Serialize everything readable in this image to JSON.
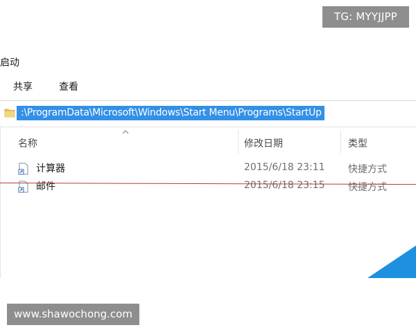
{
  "watermarks": {
    "top_right": "TG: MYYJJPP",
    "bottom_left": "www.shawochong.com"
  },
  "window": {
    "title": "启动"
  },
  "ribbon": {
    "tabs": [
      {
        "label": "共享"
      },
      {
        "label": "查看"
      }
    ]
  },
  "address_bar": {
    "path": ":\\ProgramData\\Microsoft\\Windows\\Start Menu\\Programs\\StartUp",
    "icon": "folder-icon",
    "selection_color": "#3390e6"
  },
  "file_list": {
    "columns": [
      {
        "label": "名称"
      },
      {
        "label": "修改日期"
      },
      {
        "label": "类型"
      }
    ],
    "sort_indicator": "sort-up-arrow",
    "rows": [
      {
        "name": "计算器",
        "modified": "2015/6/18 23:11",
        "type": "快捷方式",
        "icon": "shortcut-icon"
      },
      {
        "name": "邮件",
        "modified": "2015/6/18 23:15",
        "type": "快捷方式",
        "icon": "shortcut-icon"
      }
    ]
  },
  "colors": {
    "annotation_line": "#b23a3a",
    "accent_blue": "#1e90e0"
  }
}
